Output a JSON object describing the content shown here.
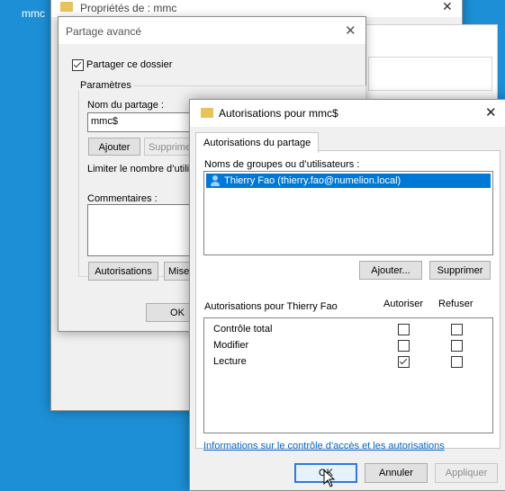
{
  "desktop": {
    "label": "mmc"
  },
  "properties_window": {
    "title": "Propriétés de : mmc"
  },
  "advanced_sharing": {
    "title": "Partage avancé",
    "share_folder_label": "Partager ce dossier",
    "share_folder_checked": true,
    "settings_group": "Paramètres",
    "share_name_label": "Nom du partage :",
    "share_name_value": "mmc$",
    "add_button": "Ajouter",
    "remove_button": "Supprimer",
    "limit_users_label": "Limiter le nombre d’utilisa",
    "comments_label": "Commentaires :",
    "permissions_button": "Autorisations",
    "cache_button": "Mise",
    "ok_button": "OK"
  },
  "permissions_dialog": {
    "title": "Autorisations pour mmc$",
    "tab": "Autorisations du partage",
    "groups_label": "Noms de groupes ou d’utilisateurs :",
    "users": [
      {
        "name": "Thierry Fao (thierry.fao@numelion.local)",
        "icon": "user-icon",
        "selected": true
      }
    ],
    "add_button": "Ajouter...",
    "remove_button": "Supprimer",
    "permissions_for_label": "Autorisations pour Thierry Fao",
    "allow_header": "Autoriser",
    "deny_header": "Refuser",
    "permissions": [
      {
        "name": "Contrôle total",
        "allow": false,
        "deny": false
      },
      {
        "name": "Modifier",
        "allow": false,
        "deny": false
      },
      {
        "name": "Lecture",
        "allow": true,
        "deny": false
      }
    ],
    "info_link": "Informations sur le contrôle d’accès et les autorisations",
    "ok_button": "OK",
    "cancel_button": "Annuler",
    "apply_button": "Appliquer",
    "apply_disabled": true
  },
  "colors": {
    "desktop": "#1d8fd6",
    "selection": "#0078d7",
    "link": "#0066cc",
    "default_button_border": "#2f79d8"
  }
}
